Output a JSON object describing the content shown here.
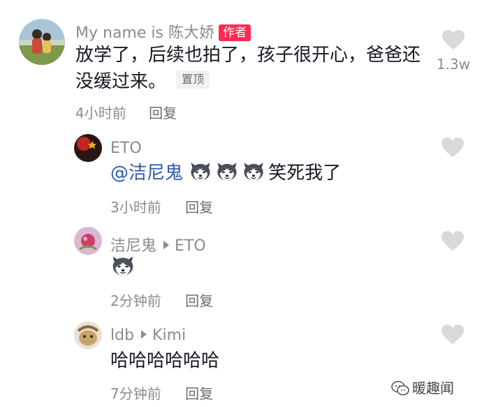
{
  "comments": [
    {
      "user": "My name is  陈大娇",
      "badge": "作者",
      "text": "放学了，后续也拍了，孩子很开心，爸爸还没缓过来。",
      "pin": "置顶",
      "time": "4小时前",
      "reply": "回复",
      "likes": "1.3w"
    }
  ],
  "replies": [
    {
      "user": "ETO",
      "mention": "@洁尼鬼",
      "emoji_count": 3,
      "emoji_icon": "husky-dog-emoji-icon",
      "text": "笑死我了",
      "time": "3小时前",
      "reply": "回复"
    },
    {
      "user": "洁尼鬼",
      "reply_to": "ETO",
      "emoji_count": 1,
      "emoji_icon": "husky-dog-emoji-icon",
      "time": "2分钟前",
      "reply": "回复"
    },
    {
      "user": "ldb",
      "reply_to": "Kimi",
      "text": "哈哈哈哈哈哈",
      "time": "7分钟前",
      "reply": "回复"
    }
  ],
  "watermark": {
    "text": "暖趣闻",
    "icon": "wechat-icon"
  },
  "colors": {
    "badge": "#fe2c55",
    "mention": "#2c5aa8",
    "muted": "#8a8b91",
    "heart": "#d9d9db"
  }
}
